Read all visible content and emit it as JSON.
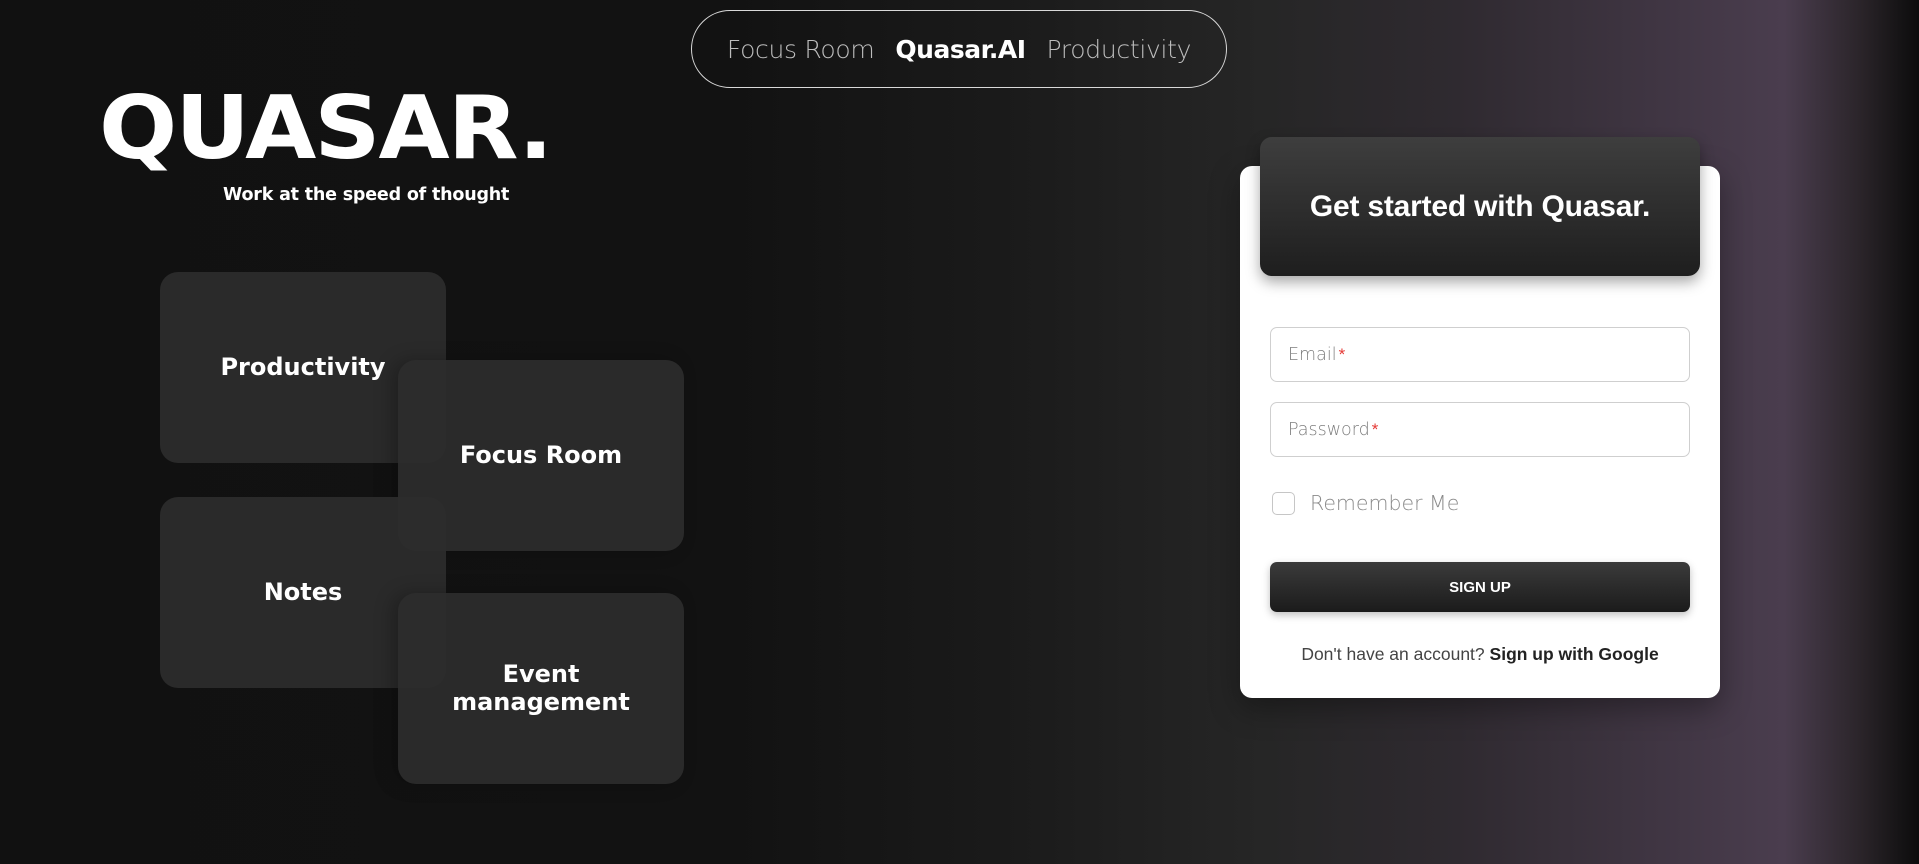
{
  "nav": {
    "items": [
      {
        "label": "Focus Room"
      },
      {
        "label": "Quasar.AI"
      },
      {
        "label": "Productivity"
      }
    ]
  },
  "logo": {
    "text": "QUASAR.",
    "tagline": "Work at the speed of thought"
  },
  "cards": [
    {
      "label": "Productivity"
    },
    {
      "label": "Focus Room"
    },
    {
      "label": "Notes"
    },
    {
      "label": "Event management"
    }
  ],
  "signup": {
    "title": "Get started with Quasar.",
    "email_label": "Email",
    "password_label": "Password",
    "required_mark": "*",
    "remember_label": "Remember Me",
    "button_label": "SIGN UP",
    "footer_text": "Don't have an account?",
    "google_link": "Sign up with Google"
  },
  "colors": {
    "background_dark": "#111111",
    "background_accent": "#4a3d4e",
    "required": "#e53935"
  }
}
